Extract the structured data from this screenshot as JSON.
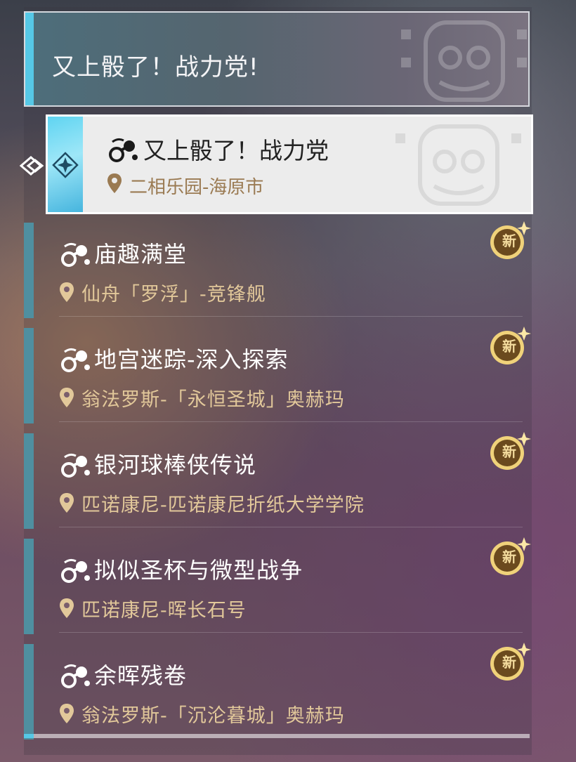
{
  "header": {
    "title": "又上骰了！战力党!"
  },
  "selected": {
    "title": "又上骰了！战力党",
    "location": "二相乐园-海原市"
  },
  "items": [
    {
      "name": "庙趣满堂",
      "location": "仙舟「罗浮」-竞锋舰",
      "badge": "新"
    },
    {
      "name": "地宫迷踪-深入探索",
      "location": "翁法罗斯-「永恒圣城」奥赫玛",
      "badge": "新"
    },
    {
      "name": "银河球棒侠传说",
      "location": "匹诺康尼-匹诺康尼折纸大学学院",
      "badge": "新"
    },
    {
      "name": "拟似圣杯与微型战争",
      "location": "匹诺康尼-晖长石号",
      "badge": "新"
    },
    {
      "name": "余晖残卷",
      "location": "翁法罗斯-「沉沦暮城」奥赫玛",
      "badge": "新"
    }
  ],
  "icons": {
    "quest": "quest-icon",
    "location": "location-pin-icon",
    "new": "new-badge-icon",
    "pointer": "selection-pointer-icon"
  },
  "colors": {
    "accent_cyan": "#56c8e6",
    "location_gold": "#e2c89a",
    "badge_gold": "#f4dc9e"
  }
}
